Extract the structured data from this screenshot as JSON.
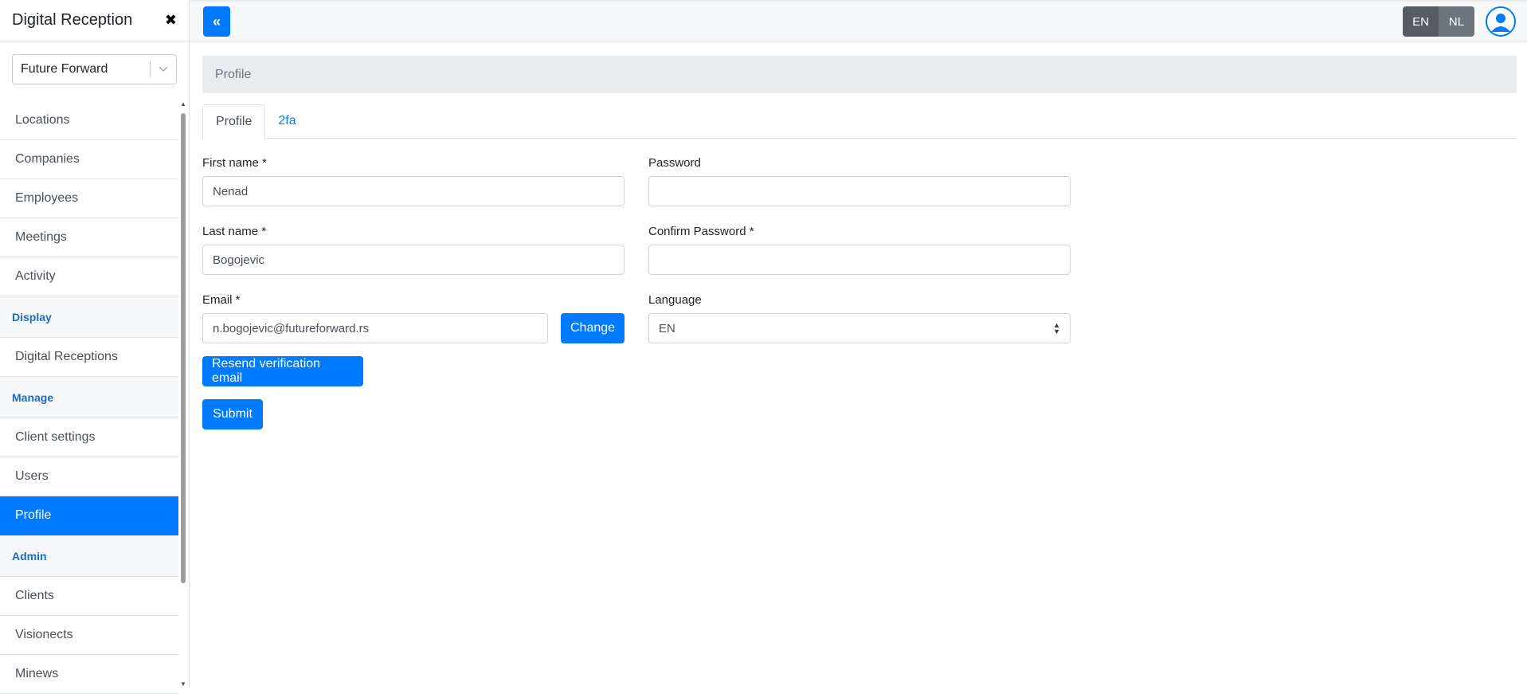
{
  "sidebar": {
    "title": "Digital Reception",
    "close_icon": "close-icon",
    "client_select": {
      "value": "Future Forward"
    },
    "items": [
      {
        "label": "Locations"
      },
      {
        "label": "Companies"
      },
      {
        "label": "Employees"
      },
      {
        "label": "Meetings"
      },
      {
        "label": "Activity"
      }
    ],
    "section_display": "Display",
    "display_items": [
      {
        "label": "Digital Receptions"
      }
    ],
    "section_manage": "Manage",
    "manage_items": [
      {
        "label": "Client settings"
      },
      {
        "label": "Users"
      },
      {
        "label": "Profile"
      }
    ],
    "section_admin": "Admin",
    "admin_items": [
      {
        "label": "Clients"
      },
      {
        "label": "Visionects"
      },
      {
        "label": "Minews"
      }
    ]
  },
  "topbar": {
    "collapse_icon": "double-chevron-left-icon",
    "languages": [
      "EN",
      "NL"
    ],
    "active_language": "EN",
    "avatar_icon": "user-avatar-icon"
  },
  "breadcrumb": "Profile",
  "tabs": [
    {
      "label": "Profile",
      "active": true
    },
    {
      "label": "2fa",
      "active": false
    }
  ],
  "form": {
    "first_name_label": "First name *",
    "first_name_value": "Nenad",
    "last_name_label": "Last name *",
    "last_name_value": "Bogojevic",
    "email_label": "Email *",
    "email_value": "n.bogojevic@futureforward.rs",
    "change_button": "Change",
    "resend_button": "Resend verification email",
    "submit_button": "Submit",
    "password_label": "Password",
    "password_value": "",
    "confirm_password_label": "Confirm Password *",
    "confirm_password_value": "",
    "language_label": "Language",
    "language_value": "EN"
  },
  "colors": {
    "primary": "#007bff",
    "section_label": "#1b6ec2",
    "lang_active": "#545b62",
    "lang_inactive": "#6c757d"
  }
}
